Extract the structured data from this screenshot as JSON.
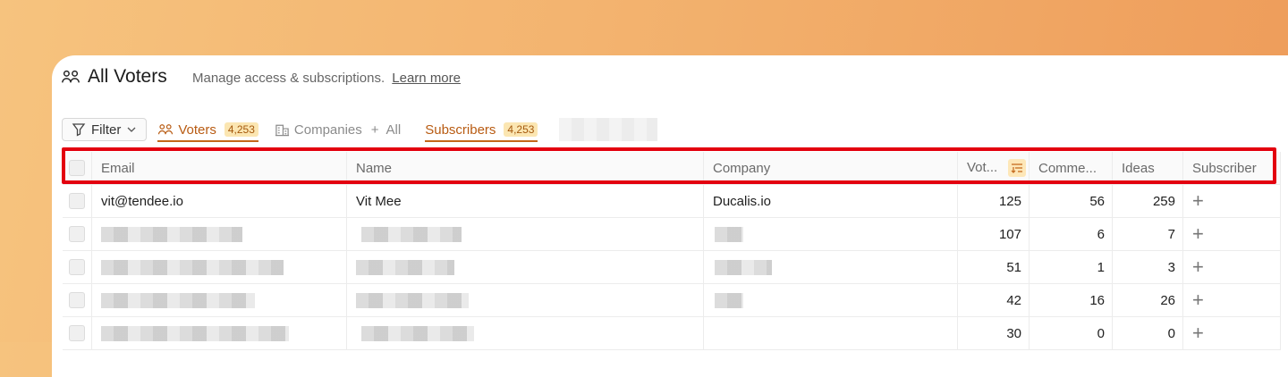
{
  "page": {
    "title": "All Voters",
    "subtitle": "Manage access & subscriptions.",
    "learn_more": "Learn more"
  },
  "toolbar": {
    "filter_label": "Filter",
    "tabs": [
      {
        "label": "Voters",
        "count": "4,253"
      },
      {
        "label": "Companies"
      },
      {
        "label": "+"
      },
      {
        "label": "All"
      },
      {
        "label": "Subscribers",
        "count": "4,253"
      }
    ]
  },
  "table": {
    "columns": [
      "Email",
      "Name",
      "Company",
      "Vot...",
      "Comme...",
      "Ideas",
      "Subscriber"
    ],
    "rows": [
      {
        "email": "vit@tendee.io",
        "name": "Vit Mee",
        "company": "Ducalis.io",
        "votes": "125",
        "comments": "56",
        "ideas": "259"
      },
      {
        "email": "",
        "name": "",
        "company": "",
        "votes": "107",
        "comments": "6",
        "ideas": "7"
      },
      {
        "email": "",
        "name": "",
        "company": "",
        "votes": "51",
        "comments": "1",
        "ideas": "3"
      },
      {
        "email": "",
        "name": "",
        "company": "",
        "votes": "42",
        "comments": "16",
        "ideas": "26"
      },
      {
        "email": "",
        "name": "",
        "company": "",
        "votes": "30",
        "comments": "0",
        "ideas": "0"
      }
    ]
  },
  "colors": {
    "accent": "#c4671a",
    "badge_bg": "#fbe6b2",
    "highlight": "#e3000f"
  },
  "icons": [
    "voters-icon",
    "filter-icon",
    "chevron-down-icon",
    "building-icon",
    "sort-icon",
    "plus-icon"
  ]
}
